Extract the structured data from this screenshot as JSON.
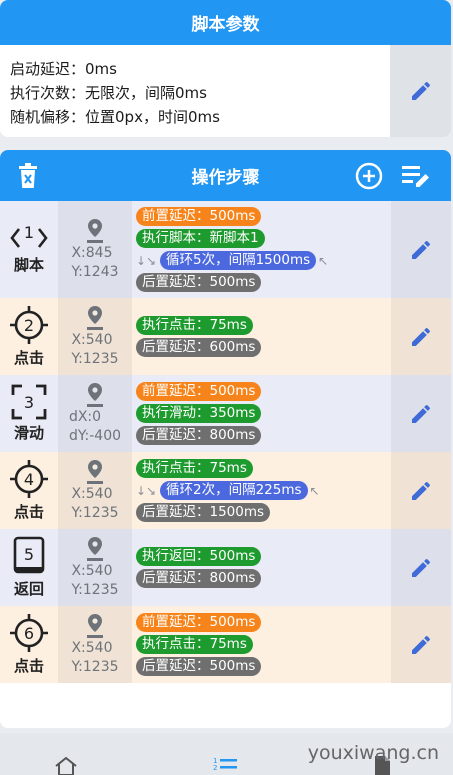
{
  "params": {
    "title": "脚本参数",
    "lines": [
      "启动延迟：0ms",
      "执行次数：无限次，间隔0ms",
      "随机偏移：位置0px，时间0ms"
    ]
  },
  "steps_header": {
    "title": "操作步骤"
  },
  "steps": [
    {
      "type_label": "脚本",
      "icon_glyph": "<1>",
      "icon": "script-icon",
      "pos": [
        "X:845",
        "Y:1243"
      ],
      "pills": [
        {
          "text": "前置延迟：500ms",
          "color": "orange"
        },
        {
          "text": "执行脚本：新脚本1",
          "color": "green"
        },
        {
          "text": "循环5次，间隔1500ms",
          "color": "blue",
          "loop": true
        },
        {
          "text": "后置延迟：500ms",
          "color": "gray"
        }
      ]
    },
    {
      "type_label": "点击",
      "icon_glyph": "2",
      "icon": "tap-target-icon",
      "pos": [
        "X:540",
        "Y:1235"
      ],
      "pills": [
        {
          "text": "执行点击：75ms",
          "color": "green"
        },
        {
          "text": "后置延迟：600ms",
          "color": "gray"
        }
      ]
    },
    {
      "type_label": "滑动",
      "icon_glyph": "3",
      "icon": "swipe-frame-icon",
      "pos": [
        "dX:0",
        "dY:-400"
      ],
      "pills": [
        {
          "text": "前置延迟：500ms",
          "color": "orange"
        },
        {
          "text": "执行滑动：350ms",
          "color": "green"
        },
        {
          "text": "后置延迟：800ms",
          "color": "gray"
        }
      ]
    },
    {
      "type_label": "点击",
      "icon_glyph": "4",
      "icon": "tap-target-icon",
      "pos": [
        "X:540",
        "Y:1235"
      ],
      "pills": [
        {
          "text": "执行点击：75ms",
          "color": "green"
        },
        {
          "text": "循环2次，间隔225ms",
          "color": "blue",
          "loop": true
        },
        {
          "text": "后置延迟：1500ms",
          "color": "gray"
        }
      ]
    },
    {
      "type_label": "返回",
      "icon_glyph": "5",
      "icon": "back-icon",
      "pos": [
        "X:540",
        "Y:1235"
      ],
      "pills": [
        {
          "text": "执行返回：500ms",
          "color": "green"
        },
        {
          "text": "后置延迟：800ms",
          "color": "gray"
        }
      ]
    },
    {
      "type_label": "点击",
      "icon_glyph": "6",
      "icon": "tap-target-icon",
      "pos": [
        "X:540",
        "Y:1235"
      ],
      "pills": [
        {
          "text": "前置延迟：500ms",
          "color": "orange"
        },
        {
          "text": "执行点击：75ms",
          "color": "green"
        },
        {
          "text": "后置延迟：500ms",
          "color": "gray"
        }
      ]
    }
  ],
  "watermark": "youxiwang.cn",
  "colors": {
    "accent": "#2196f3",
    "row_blue": "#e9ebf7",
    "row_orange": "#fdf0e1"
  }
}
